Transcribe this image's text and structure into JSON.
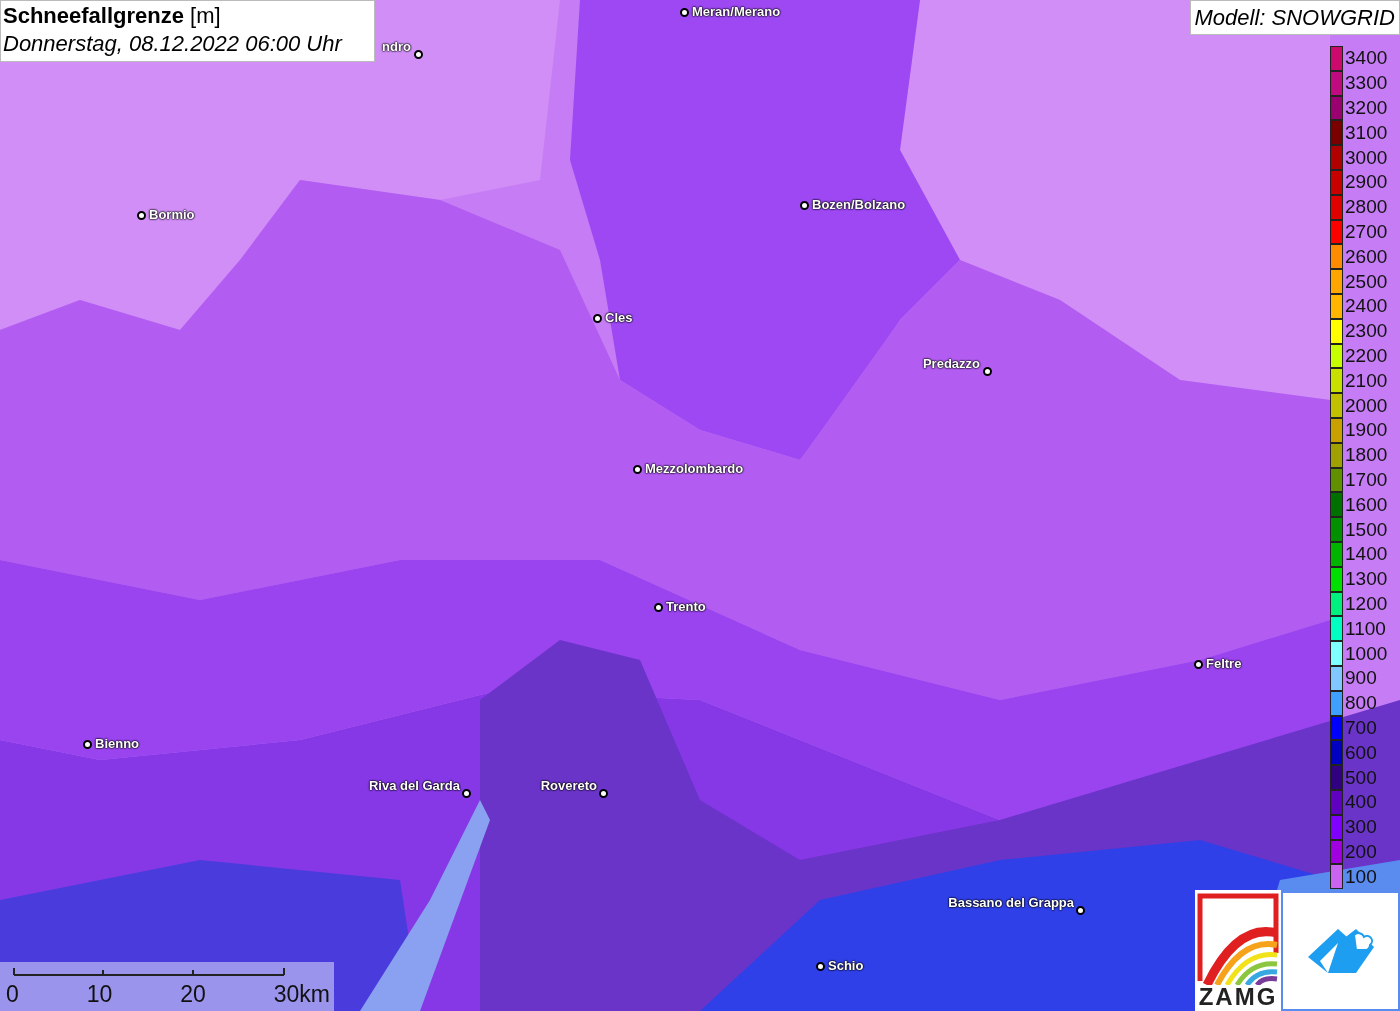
{
  "title": {
    "heading": "**Schneefallgrenze** [m]",
    "date": "Donnerstag, 08.12.2022 06:00 Uhr"
  },
  "model": "Modell: SNOWGRID",
  "places": [
    {
      "name": "ndro"
    },
    {
      "name": "Meran/Merano"
    },
    {
      "name": "Bozen/Bolzano"
    },
    {
      "name": "Bormio"
    },
    {
      "name": "Cles"
    },
    {
      "name": "Predazzo"
    },
    {
      "name": "Mezzolombardo"
    },
    {
      "name": "Trento"
    },
    {
      "name": "Feltre"
    },
    {
      "name": "Bienno"
    },
    {
      "name": "Riva del Garda"
    },
    {
      "name": "Rovereto"
    },
    {
      "name": "Bassano del Grappa"
    },
    {
      "name": "Schio"
    }
  ],
  "legend": [
    {
      "label": "3400",
      "color": "#cc0a6e"
    },
    {
      "label": "3300",
      "color": "#c00a80"
    },
    {
      "label": "3200",
      "color": "#9a0070"
    },
    {
      "label": "3100",
      "color": "#7a0000"
    },
    {
      "label": "3000",
      "color": "#b00000"
    },
    {
      "label": "2900",
      "color": "#c80000"
    },
    {
      "label": "2800",
      "color": "#e00000"
    },
    {
      "label": "2700",
      "color": "#ff0000"
    },
    {
      "label": "2600",
      "color": "#ff8c00"
    },
    {
      "label": "2500",
      "color": "#ffa500"
    },
    {
      "label": "2400",
      "color": "#ffb400"
    },
    {
      "label": "2300",
      "color": "#ffff00"
    },
    {
      "label": "2200",
      "color": "#c8ff00"
    },
    {
      "label": "2100",
      "color": "#c8e000"
    },
    {
      "label": "2000",
      "color": "#c0c000"
    },
    {
      "label": "1900",
      "color": "#c8a000"
    },
    {
      "label": "1800",
      "color": "#a0a000"
    },
    {
      "label": "1700",
      "color": "#609000"
    },
    {
      "label": "1600",
      "color": "#007000"
    },
    {
      "label": "1500",
      "color": "#009000"
    },
    {
      "label": "1400",
      "color": "#00b400"
    },
    {
      "label": "1300",
      "color": "#00e000"
    },
    {
      "label": "1200",
      "color": "#00f080"
    },
    {
      "label": "1100",
      "color": "#00ffc0"
    },
    {
      "label": "1000",
      "color": "#80ffff"
    },
    {
      "label": "900",
      "color": "#80c8ff"
    },
    {
      "label": "800",
      "color": "#40a0ff"
    },
    {
      "label": "700",
      "color": "#0000ff"
    },
    {
      "label": "600",
      "color": "#0000c0"
    },
    {
      "label": "500",
      "color": "#300080"
    },
    {
      "label": "400",
      "color": "#6000c0"
    },
    {
      "label": "300",
      "color": "#8000ff"
    },
    {
      "label": "200",
      "color": "#a000e0"
    },
    {
      "label": "100",
      "color": "#c864f0"
    }
  ],
  "scale_bar": {
    "labels": [
      "0",
      "10",
      "20",
      "30km"
    ]
  },
  "logo": {
    "text": "ZAMG"
  }
}
